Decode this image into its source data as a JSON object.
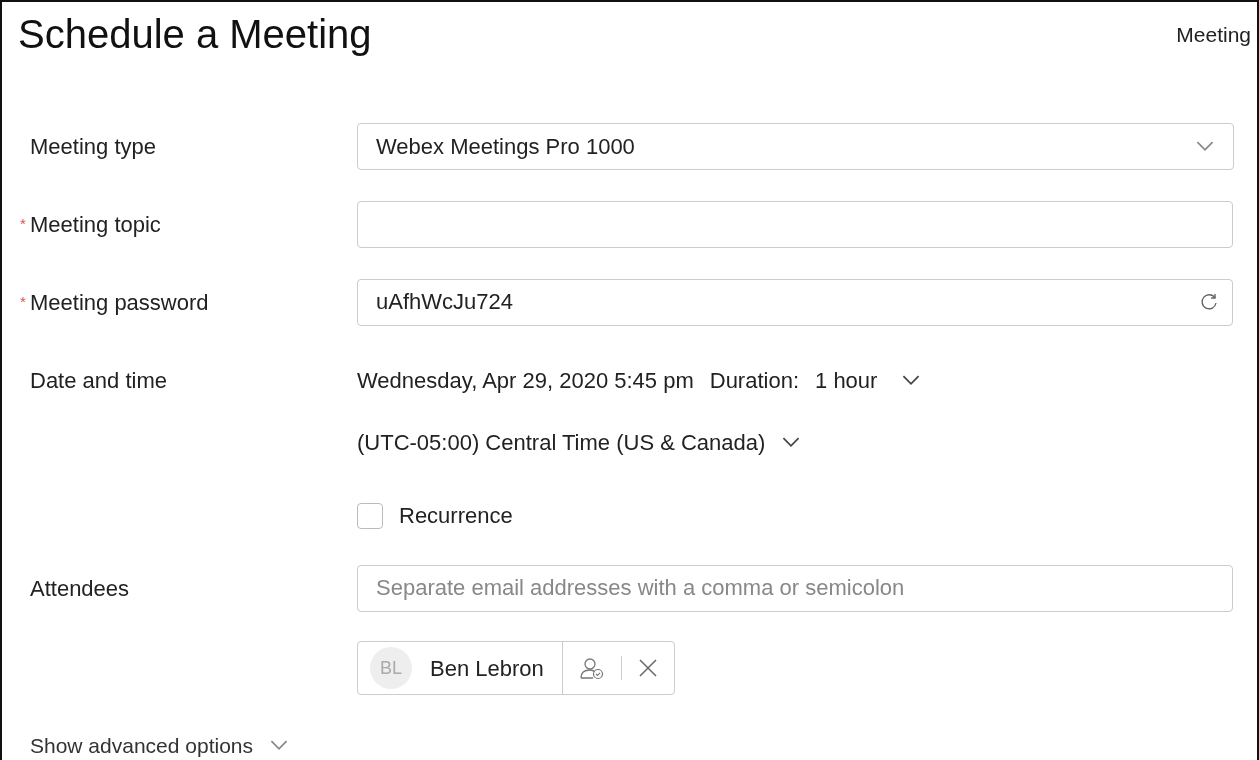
{
  "title": "Schedule a Meeting",
  "header_link": "Meeting",
  "required_marker": "*",
  "fields": [
    {
      "kind": "select",
      "label": "Meeting type",
      "required": false,
      "value": "Webex Meetings Pro 1000"
    },
    {
      "kind": "text",
      "label": "Meeting topic",
      "required": true
    },
    {
      "kind": "password",
      "label": "Meeting password",
      "required": true,
      "value": "uAfhWcJu724"
    },
    {
      "kind": "datetime",
      "label": "Date and time",
      "required": false,
      "date": "Wednesday, Apr 29, 2020 5:45 pm",
      "duration_label": "Duration:",
      "duration": "1 hour",
      "timezone": "(UTC-05:00) Central Time (US & Canada)",
      "recurrence": {
        "label": "Recurrence",
        "checked": false
      }
    },
    {
      "kind": "attendees",
      "label": "Attendees",
      "required": false,
      "placeholder": "Separate email addresses with a comma or semicolon",
      "attendees": [
        {
          "initials": "BL",
          "name": "Ben Lebron"
        }
      ]
    }
  ],
  "advanced_link": "Show advanced options"
}
